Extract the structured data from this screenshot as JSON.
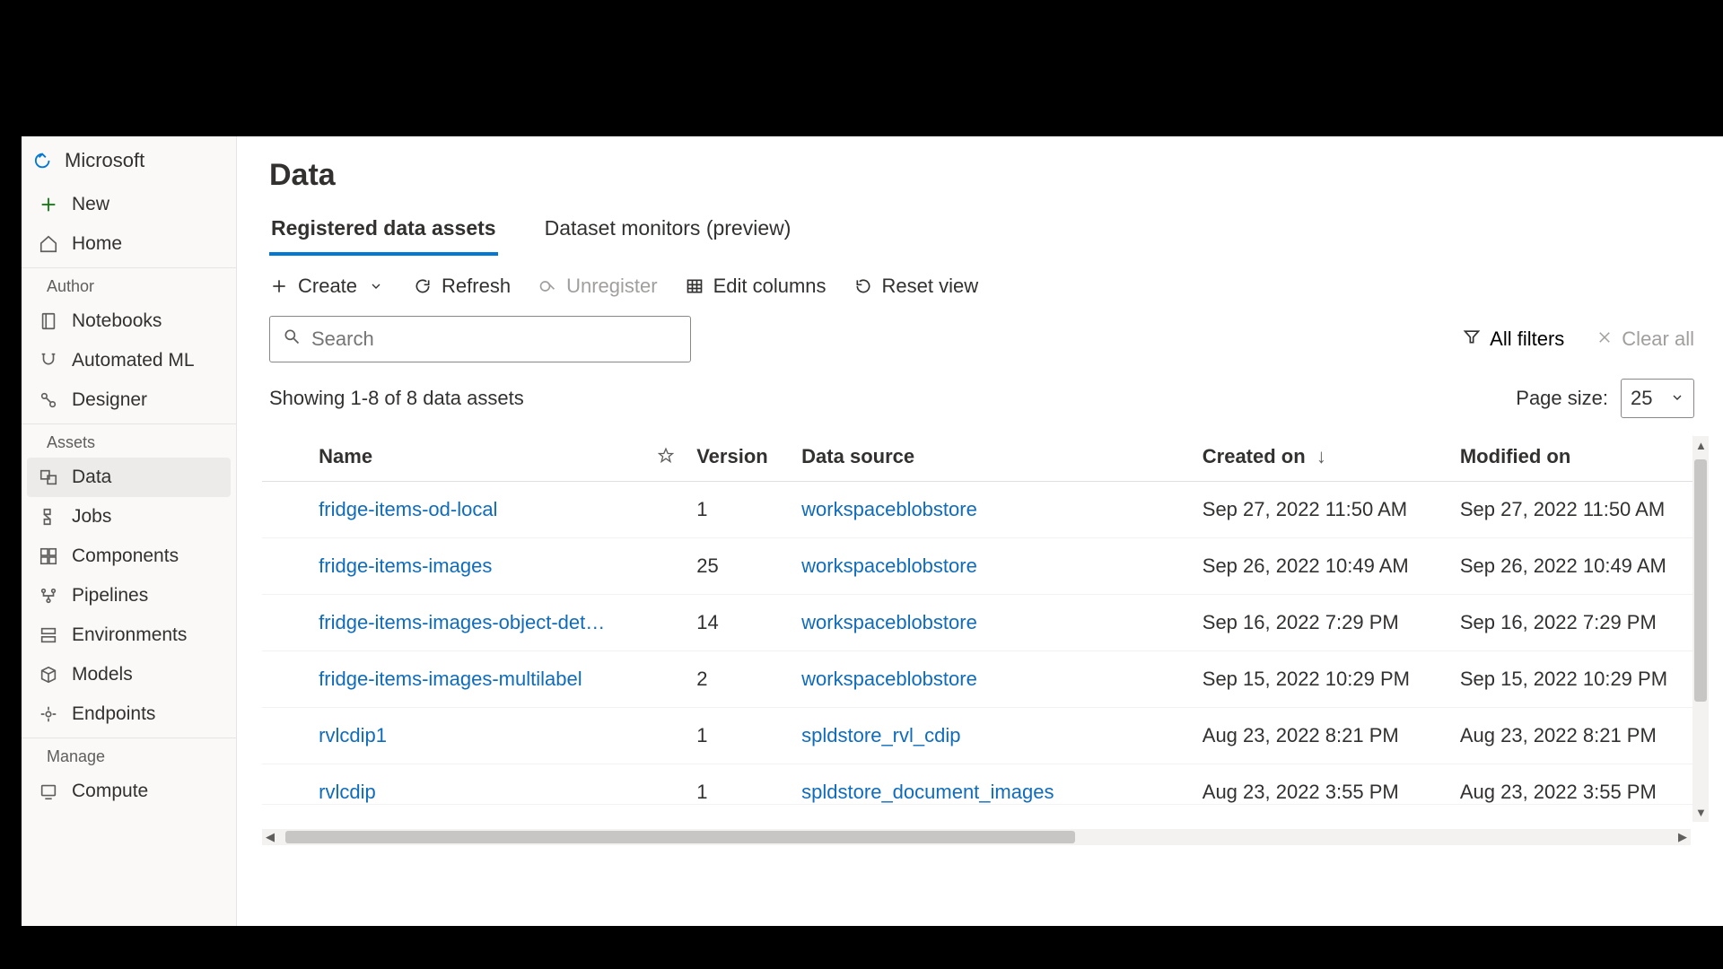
{
  "sidebar": {
    "brand": "Microsoft",
    "new_label": "New",
    "home_label": "Home",
    "section_author": "Author",
    "section_assets": "Assets",
    "section_manage": "Manage",
    "items_author": [
      {
        "label": "Notebooks"
      },
      {
        "label": "Automated ML"
      },
      {
        "label": "Designer"
      }
    ],
    "items_assets": [
      {
        "label": "Data"
      },
      {
        "label": "Jobs"
      },
      {
        "label": "Components"
      },
      {
        "label": "Pipelines"
      },
      {
        "label": "Environments"
      },
      {
        "label": "Models"
      },
      {
        "label": "Endpoints"
      }
    ],
    "items_manage": [
      {
        "label": "Compute"
      }
    ]
  },
  "main": {
    "title": "Data",
    "tabs": [
      {
        "label": "Registered data assets",
        "active": true
      },
      {
        "label": "Dataset monitors (preview)",
        "active": false
      }
    ],
    "toolbar": {
      "create": "Create",
      "refresh": "Refresh",
      "unregister": "Unregister",
      "edit_columns": "Edit columns",
      "reset_view": "Reset view"
    },
    "search_placeholder": "Search",
    "all_filters": "All filters",
    "clear_all": "Clear all",
    "showing_text": "Showing 1-8 of 8 data assets",
    "page_size_label": "Page size:",
    "page_size_value": "25",
    "columns": {
      "name": "Name",
      "version": "Version",
      "data_source": "Data source",
      "created_on": "Created on",
      "modified_on": "Modified on"
    },
    "rows": [
      {
        "name": "fridge-items-od-local",
        "version": "1",
        "source": "workspaceblobstore",
        "created": "Sep 27, 2022 11:50 AM",
        "modified": "Sep 27, 2022 11:50 AM"
      },
      {
        "name": "fridge-items-images",
        "version": "25",
        "source": "workspaceblobstore",
        "created": "Sep 26, 2022 10:49 AM",
        "modified": "Sep 26, 2022 10:49 AM"
      },
      {
        "name": "fridge-items-images-object-det…",
        "version": "14",
        "source": "workspaceblobstore",
        "created": "Sep 16, 2022 7:29 PM",
        "modified": "Sep 16, 2022 7:29 PM"
      },
      {
        "name": "fridge-items-images-multilabel",
        "version": "2",
        "source": "workspaceblobstore",
        "created": "Sep 15, 2022 10:29 PM",
        "modified": "Sep 15, 2022 10:29 PM"
      },
      {
        "name": "rvlcdip1",
        "version": "1",
        "source": "spldstore_rvl_cdip",
        "created": "Aug 23, 2022 8:21 PM",
        "modified": "Aug 23, 2022 8:21 PM"
      },
      {
        "name": "rvlcdip",
        "version": "1",
        "source": "spldstore_document_images",
        "created": "Aug 23, 2022 3:55 PM",
        "modified": "Aug 23, 2022 3:55 PM"
      }
    ]
  }
}
